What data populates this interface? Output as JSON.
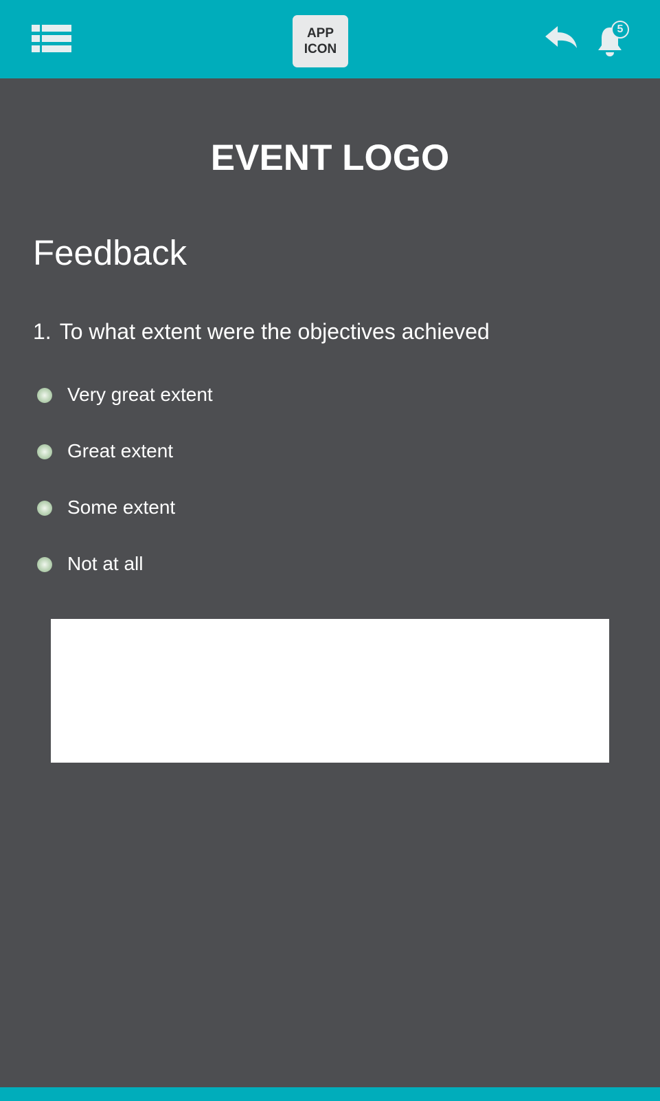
{
  "header": {
    "app_icon_label": "APP\nICON",
    "notification_count": "5",
    "bar_color": "#00adbb",
    "menu_icon": "list-icon",
    "back_icon": "reply-arrow-icon",
    "bell_icon": "bell-icon"
  },
  "event": {
    "logo_text": "EVENT LOGO"
  },
  "page": {
    "title": "Feedback",
    "background_color": "#4d4e51"
  },
  "question": {
    "number": "1.",
    "text": "To what extent were the objectives achieved",
    "options": [
      {
        "label": "Very great extent"
      },
      {
        "label": "Great extent"
      },
      {
        "label": "Some extent"
      },
      {
        "label": "Not at all"
      }
    ]
  },
  "comment": {
    "value": "",
    "placeholder": ""
  }
}
